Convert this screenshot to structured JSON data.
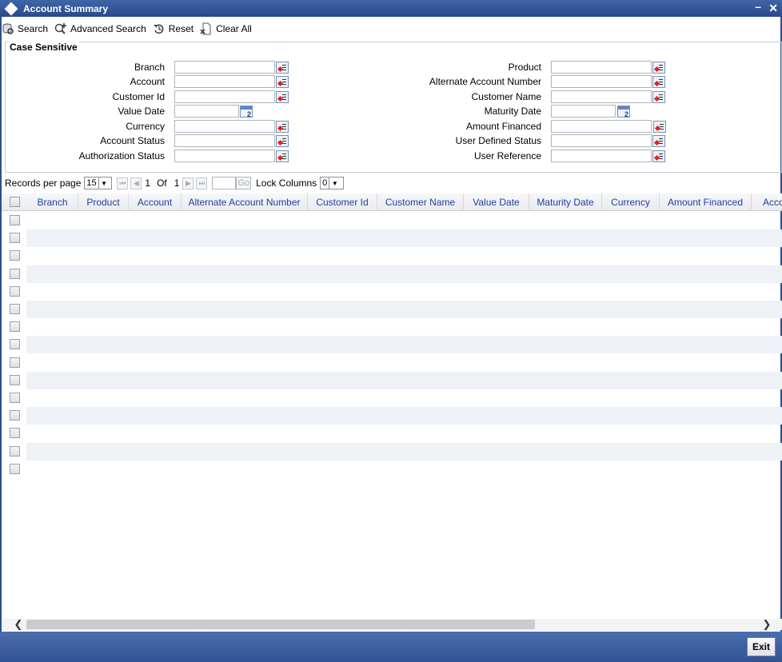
{
  "window": {
    "title": "Account Summary",
    "minimize": "–",
    "close": "✕"
  },
  "toolbar": {
    "search": "Search",
    "advanced_search": "Advanced Search",
    "reset": "Reset",
    "clear_all": "Clear All"
  },
  "criteria": {
    "legend": "Case Sensitive",
    "left_fields": [
      "Branch",
      "Account",
      "Customer Id",
      "Value Date",
      "Currency",
      "Account Status",
      "Authorization Status"
    ],
    "right_fields": [
      "Product",
      "Alternate Account Number",
      "Customer Name",
      "Maturity Date",
      "Amount Financed",
      "User Defined Status",
      "User Reference"
    ]
  },
  "pager": {
    "records_per_page_label": "Records per page",
    "records_per_page": "15",
    "current_page": "1",
    "of_label": "Of",
    "total_pages": "1",
    "go_label": "Go",
    "lock_columns_label": "Lock Columns",
    "lock_columns": "0"
  },
  "grid": {
    "columns": [
      "Branch",
      "Product",
      "Account",
      "Alternate Account Number",
      "Customer Id",
      "Customer Name",
      "Value Date",
      "Maturity Date",
      "Currency",
      "Amount Financed",
      "Acco"
    ],
    "row_count": 15
  },
  "footer": {
    "exit": "Exit"
  },
  "colors": {
    "title_bar": "#2f5394",
    "header_text": "#1f3fa0",
    "row_stripe": "#eef1f6"
  }
}
